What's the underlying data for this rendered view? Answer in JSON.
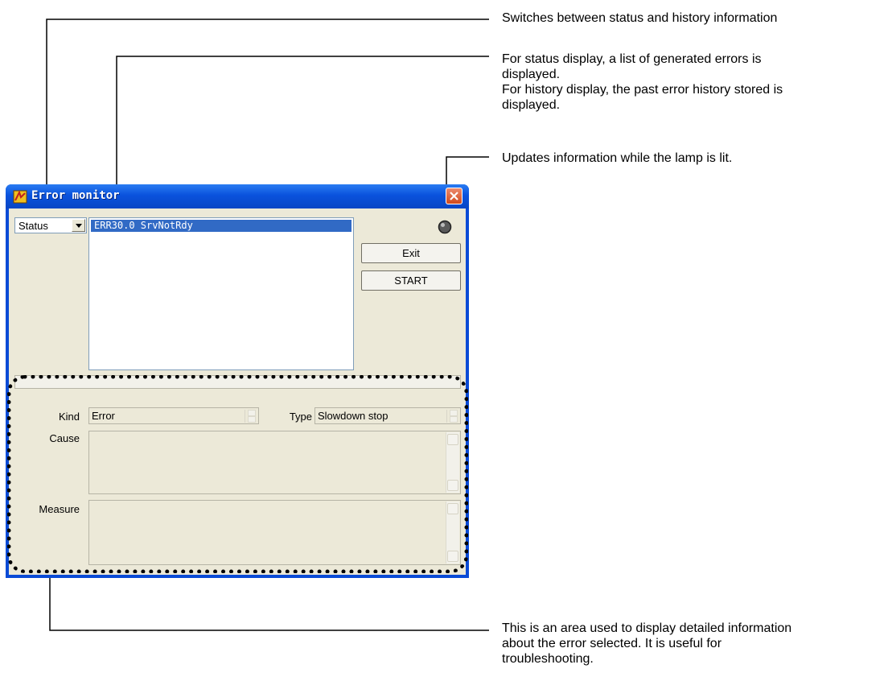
{
  "callouts": [
    {
      "lines": [
        "Switches between status and history information"
      ]
    },
    {
      "lines": [
        "For status display, a list of generated errors is",
        "displayed.",
        "For history display, the past error history stored is",
        "displayed."
      ]
    },
    {
      "lines": [
        "Updates information while the lamp is lit."
      ]
    },
    {
      "lines": [
        "This is an area used to display detailed information",
        "about the error selected. It is useful for",
        "troubleshooting."
      ]
    }
  ],
  "window": {
    "title": "Error monitor",
    "mode_select": {
      "value": "Status"
    },
    "error_list": [
      "ERR30.0 SrvNotRdy"
    ],
    "buttons": {
      "exit": "Exit",
      "start": "START"
    },
    "detail": {
      "kind_label": "Kind",
      "kind_value": "Error",
      "type_label": "Type",
      "type_value": "Slowdown stop",
      "cause_label": "Cause",
      "cause_value": "",
      "measure_label": "Measure",
      "measure_value": ""
    }
  },
  "colors": {
    "title_bar": "#0a52dd",
    "selection": "#316ac5",
    "dialog_bg": "#ece9d8",
    "close_button": "#d24a1c"
  },
  "icons": [
    "app-icon",
    "close-icon",
    "dropdown-arrow-icon",
    "lamp-icon",
    "scroll-up-icon",
    "scroll-down-icon"
  ]
}
